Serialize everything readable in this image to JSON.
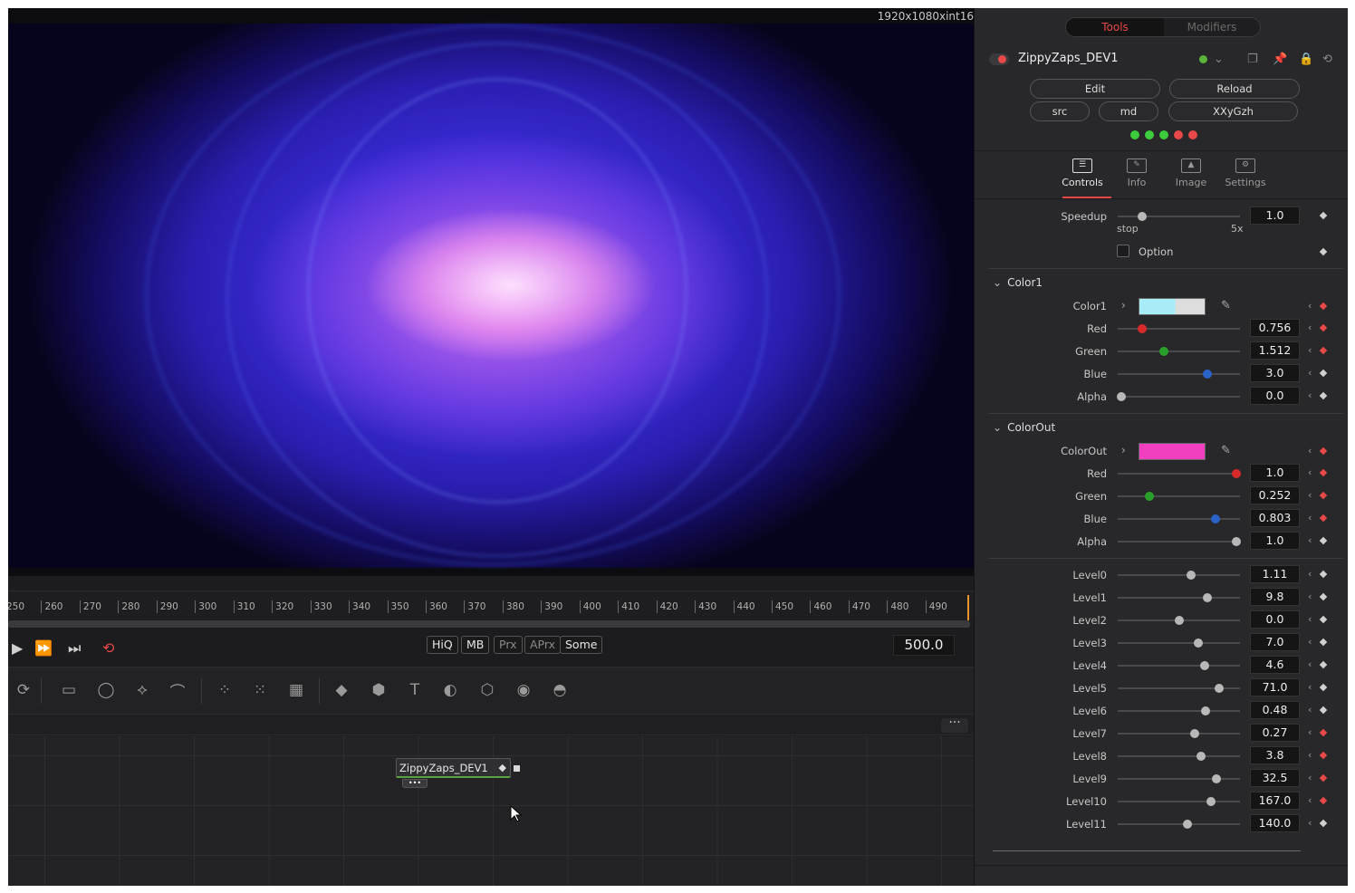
{
  "viewer": {
    "resolution": "1920x1080xint16"
  },
  "timeline": {
    "ticks": [
      "250",
      "260",
      "270",
      "280",
      "290",
      "300",
      "310",
      "320",
      "330",
      "340",
      "350",
      "360",
      "370",
      "380",
      "390",
      "400",
      "410",
      "420",
      "430",
      "440",
      "450",
      "460",
      "470",
      "480",
      "490"
    ],
    "current_frame": "500.0"
  },
  "transport": {
    "buttons": [
      "HiQ",
      "MB",
      "Prx",
      "APrx",
      "Some"
    ],
    "icons": [
      "play-icon",
      "fast-forward-icon",
      "skip-to-end-icon",
      "loop-icon"
    ]
  },
  "toolbar_icons": [
    "background-icon",
    "rectangle-mask-icon",
    "ellipse-mask-icon",
    "polygon-mask-icon",
    "bspline-mask-icon",
    "particle-emitter-icon",
    "particle-render-icon",
    "particle-grid-icon",
    "shape3d-icon",
    "merge3d-icon",
    "text3d-icon",
    "camera3d-icon",
    "renderer3d-icon",
    "light3d-icon",
    "imageplane3d-icon"
  ],
  "node": {
    "label": "ZippyZaps_DEV1"
  },
  "panel": {
    "tabs": {
      "tools": "Tools",
      "modifiers": "Modifiers"
    },
    "tool_name": "ZippyZaps_DEV1",
    "buttons": {
      "edit": "Edit",
      "reload": "Reload",
      "src": "src",
      "md": "md",
      "xxygzh": "XXyGzh"
    },
    "status_dots": [
      "#3dcc3d",
      "#3dcc3d",
      "#3dcc3d",
      "#e84848",
      "#e84848"
    ],
    "subtabs": [
      "Controls",
      "Info",
      "Image",
      "Settings"
    ],
    "speedup": {
      "label": "Speedup",
      "value": "1.0",
      "min_label": "stop",
      "max_label": "5x",
      "fraction": 0.2
    },
    "option": {
      "label": "Option"
    },
    "color1": {
      "section": "Color1",
      "label": "Color1",
      "swatch": "#a8ecf8",
      "rows": [
        {
          "label": "Red",
          "value": "0.756",
          "fraction": 0.2,
          "knob": "#d82a2a"
        },
        {
          "label": "Green",
          "value": "1.512",
          "fraction": 0.38,
          "knob": "#2aa02a"
        },
        {
          "label": "Blue",
          "value": "3.0",
          "fraction": 0.73,
          "knob": "#2a62c8"
        },
        {
          "label": "Alpha",
          "value": "0.0",
          "fraction": 0.03,
          "knob": "#b8b8b8"
        }
      ]
    },
    "colorout": {
      "section": "ColorOut",
      "label": "ColorOut",
      "swatch": "#f040c0",
      "rows": [
        {
          "label": "Red",
          "value": "1.0",
          "fraction": 0.97,
          "knob": "#d82a2a"
        },
        {
          "label": "Green",
          "value": "0.252",
          "fraction": 0.26,
          "knob": "#2aa02a"
        },
        {
          "label": "Blue",
          "value": "0.803",
          "fraction": 0.8,
          "knob": "#2a62c8"
        },
        {
          "label": "Alpha",
          "value": "1.0",
          "fraction": 0.97,
          "knob": "#b8b8b8"
        }
      ]
    },
    "levels": [
      {
        "label": "Level0",
        "value": "1.11",
        "fraction": 0.6,
        "kf_red": false
      },
      {
        "label": "Level1",
        "value": "9.8",
        "fraction": 0.73,
        "kf_red": false
      },
      {
        "label": "Level2",
        "value": "0.0",
        "fraction": 0.5,
        "kf_red": false
      },
      {
        "label": "Level3",
        "value": "7.0",
        "fraction": 0.66,
        "kf_red": false
      },
      {
        "label": "Level4",
        "value": "4.6",
        "fraction": 0.71,
        "kf_red": false
      },
      {
        "label": "Level5",
        "value": "71.0",
        "fraction": 0.83,
        "kf_red": false
      },
      {
        "label": "Level6",
        "value": "0.48",
        "fraction": 0.72,
        "kf_red": false
      },
      {
        "label": "Level7",
        "value": "0.27",
        "fraction": 0.63,
        "kf_red": true
      },
      {
        "label": "Level8",
        "value": "3.8",
        "fraction": 0.68,
        "kf_red": true
      },
      {
        "label": "Level9",
        "value": "32.5",
        "fraction": 0.81,
        "kf_red": true
      },
      {
        "label": "Level10",
        "value": "167.0",
        "fraction": 0.76,
        "kf_red": true
      },
      {
        "label": "Level11",
        "value": "140.0",
        "fraction": 0.57,
        "kf_red": false
      }
    ]
  }
}
